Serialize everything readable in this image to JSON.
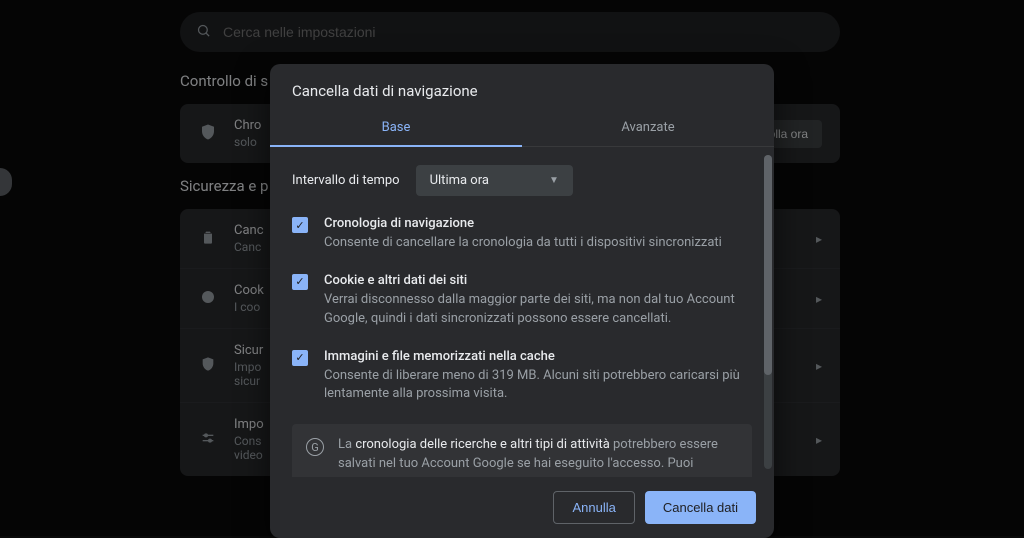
{
  "search": {
    "placeholder": "Cerca nelle impostazioni"
  },
  "sections": {
    "safety_title": "Controllo di s",
    "safety_row": {
      "line1": "Chro",
      "line2": "solo",
      "button": "olla ora"
    },
    "privacy_title": "Sicurezza e p",
    "rows": {
      "r1": {
        "title": "Canc",
        "sub": "Canc"
      },
      "r2": {
        "title": "Cook",
        "sub": "I coo"
      },
      "r3": {
        "title": "Sicur",
        "sub1": "Impo",
        "sub2": "sicur"
      },
      "r4": {
        "title": "Impo",
        "sub1": "Cons",
        "sub2": "video"
      }
    }
  },
  "dialog": {
    "title": "Cancella dati di navigazione",
    "tabs": {
      "basic": "Base",
      "advanced": "Avanzate"
    },
    "time_label": "Intervallo di tempo",
    "time_value": "Ultima ora",
    "items": {
      "history": {
        "title": "Cronologia di navigazione",
        "desc": "Consente di cancellare la cronologia da tutti i dispositivi sincronizzati"
      },
      "cookies": {
        "title": "Cookie e altri dati dei siti",
        "desc": "Verrai disconnesso dalla maggior parte dei siti, ma non dal tuo Account Google, quindi i dati sincronizzati possono essere cancellati."
      },
      "cache": {
        "title": "Immagini e file memorizzati nella cache",
        "desc": "Consente di liberare meno di 319 MB. Alcuni siti potrebbero caricarsi più lentamente alla prossima visita."
      }
    },
    "info_pre": "La ",
    "info_hl": "cronologia delle ricerche e altri tipi di attività",
    "info_post": " potrebbero essere salvati nel tuo Account Google se hai eseguito l'accesso. Puoi",
    "cancel": "Annulla",
    "confirm": "Cancella dati"
  }
}
